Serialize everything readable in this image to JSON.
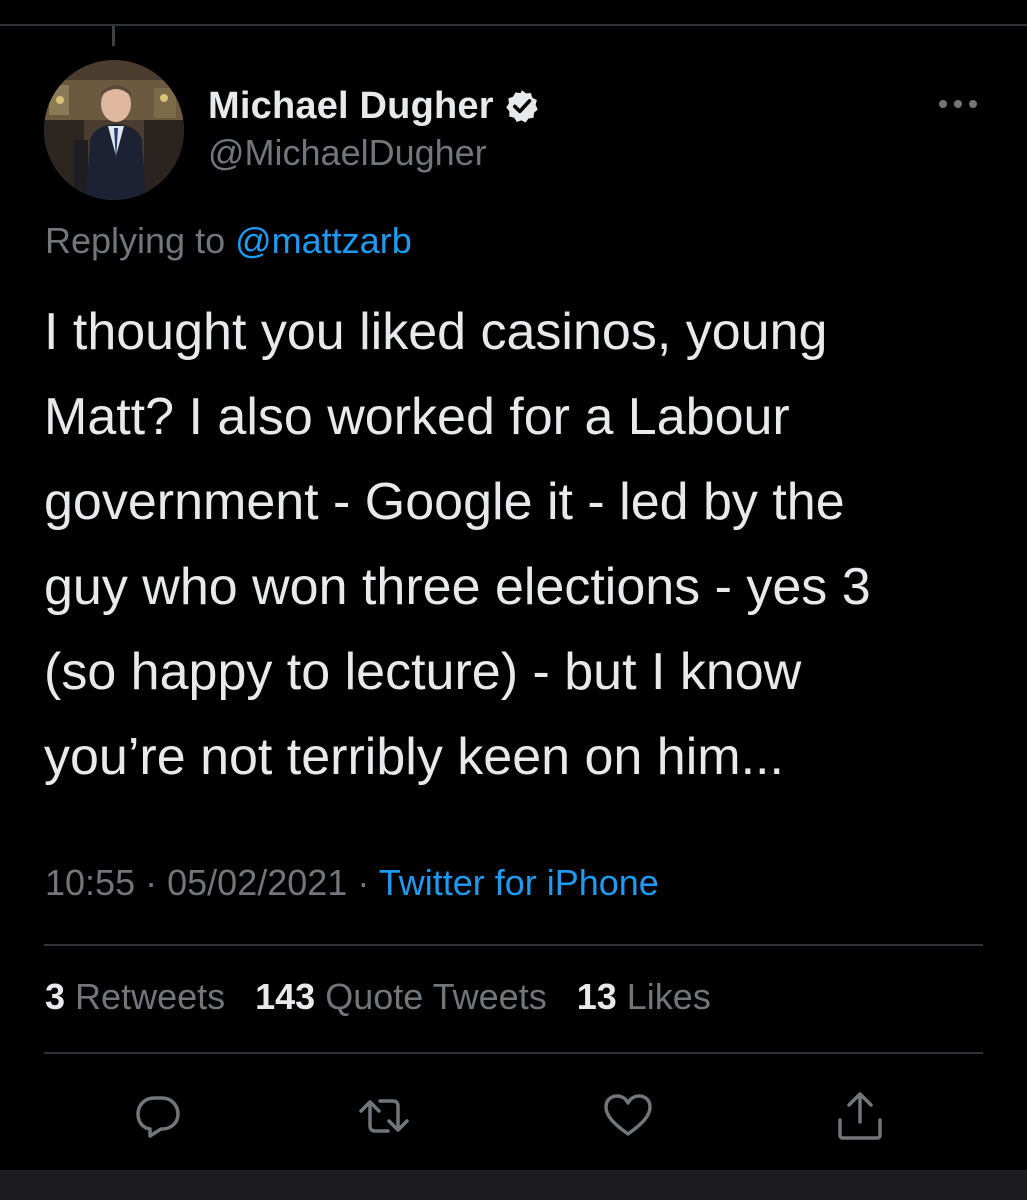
{
  "tweet": {
    "author": {
      "display_name": "Michael Dugher",
      "handle": "@MichaelDugher",
      "verified": true
    },
    "replying_to": {
      "prefix": "Replying to",
      "mention": "@mattzarb"
    },
    "text": "I thought you liked casinos, young\nMatt? I also worked for a Labour\ngovernment - Google it - led by the\nguy who won three elections - yes 3\n(so happy to lecture) - but I know\nyou’re not terribly keen on him...",
    "timestamp": {
      "time": "10:55",
      "separator": "·",
      "date": "05/02/2021",
      "source": "Twitter for iPhone"
    },
    "stats": {
      "retweets_count": "3",
      "retweets_label": "Retweets",
      "quote_tweets_count": "143",
      "quote_tweets_label": "Quote Tweets",
      "likes_count": "13",
      "likes_label": "Likes"
    },
    "actions": [
      "reply-icon",
      "retweet-icon",
      "like-icon",
      "share-icon"
    ]
  },
  "colors": {
    "background": "#000000",
    "primary_text": "#e7e9ea",
    "secondary_text": "#71767b",
    "accent": "#1d9bf0",
    "divider": "#2f3336"
  }
}
